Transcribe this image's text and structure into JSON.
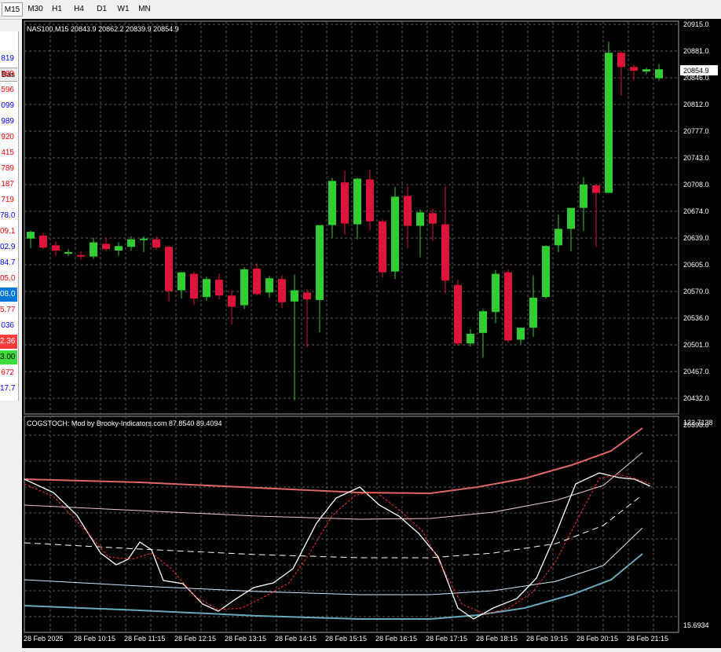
{
  "timeframes": [
    "M15",
    "M30",
    "H1",
    "H4",
    "D1",
    "W1",
    "MN"
  ],
  "active_timeframe": "M15",
  "side_panel": {
    "header": "Bas",
    "values": [
      {
        "text": "819",
        "color": "#0000ff"
      },
      {
        "text": "589",
        "color": "#ff0000"
      },
      {
        "text": "596",
        "color": "#ff0000"
      },
      {
        "text": "099",
        "color": "#0000ff"
      },
      {
        "text": "989",
        "color": "#0000ff"
      },
      {
        "text": "920",
        "color": "#ff0000"
      },
      {
        "text": "415",
        "color": "#ff0000"
      },
      {
        "text": "789",
        "color": "#ff0000"
      },
      {
        "text": "187",
        "color": "#ff0000"
      },
      {
        "text": "719",
        "color": "#ff0000"
      },
      {
        "text": "78.0",
        "color": "#0000ff"
      },
      {
        "text": "09.1",
        "color": "#ff0000"
      },
      {
        "text": "02.9",
        "color": "#0000ff"
      },
      {
        "text": "84.7",
        "color": "#0000ff"
      },
      {
        "text": "05.0",
        "color": "#ff0000"
      },
      {
        "text": "08.0",
        "color": "#ffffff",
        "bg": "#0078d7"
      },
      {
        "text": "5.77",
        "color": "#ff0000"
      },
      {
        "text": "036",
        "color": "#0000ff"
      },
      {
        "text": "2.36",
        "color": "#ffffff",
        "bg": "#ff3c3c"
      },
      {
        "text": "3.00",
        "color": "#000000",
        "bg": "#3cdc3c"
      },
      {
        "text": "672",
        "color": "#ff0000"
      },
      {
        "text": "17.7",
        "color": "#0000ff"
      }
    ]
  },
  "main_chart": {
    "info": "NAS100,M15  20843.9 20862.2 20839.9 20854.9",
    "price_labels": [
      "20915.0",
      "20881.0",
      "20846.0",
      "20812.0",
      "20777.0",
      "20743.0",
      "20708.0",
      "20674.0",
      "20639.0",
      "20605.0",
      "20570.0",
      "20536.0",
      "20501.0",
      "20467.0",
      "20432.0",
      "20398.0"
    ],
    "current_price": "20854.9",
    "colors": {
      "bull": "#32cd32",
      "bear": "#dc143c",
      "grid": "#6a6a6a",
      "text": "#ffffff"
    }
  },
  "indicator": {
    "info": "COGSTOCH: Mod by Brooky-Indicators.com 87.8540 89.4094",
    "top_label": "122.7138",
    "bottom_label": "15.6934"
  },
  "time_labels": [
    "28 Feb 2025",
    "28 Feb 10:15",
    "28 Feb 11:15",
    "28 Feb 12:15",
    "28 Feb 13:15",
    "28 Feb 14:15",
    "28 Feb 15:15",
    "28 Feb 16:15",
    "28 Feb 17:15",
    "28 Feb 18:15",
    "28 Feb 19:15",
    "28 Feb 20:15",
    "28 Feb 21:15"
  ],
  "chart_data": {
    "type": "candlestick",
    "symbol": "NAS100",
    "timeframe": "M15",
    "ylim": [
      20398.0,
      20915.0
    ],
    "candles": [
      {
        "o": 20629,
        "h": 20640,
        "l": 20616,
        "c": 20638
      },
      {
        "o": 20633,
        "h": 20637,
        "l": 20615,
        "c": 20617
      },
      {
        "o": 20620,
        "h": 20625,
        "l": 20606,
        "c": 20613
      },
      {
        "o": 20609,
        "h": 20615,
        "l": 20606,
        "c": 20611
      },
      {
        "o": 20607,
        "h": 20612,
        "l": 20601,
        "c": 20605
      },
      {
        "o": 20605,
        "h": 20630,
        "l": 20602,
        "c": 20624
      },
      {
        "o": 20622,
        "h": 20630,
        "l": 20612,
        "c": 20615
      },
      {
        "o": 20613,
        "h": 20624,
        "l": 20606,
        "c": 20619
      },
      {
        "o": 20618,
        "h": 20632,
        "l": 20613,
        "c": 20628
      },
      {
        "o": 20627,
        "h": 20632,
        "l": 20611,
        "c": 20629
      },
      {
        "o": 20628,
        "h": 20632,
        "l": 20614,
        "c": 20617
      },
      {
        "o": 20618,
        "h": 20620,
        "l": 20545,
        "c": 20559
      },
      {
        "o": 20560,
        "h": 20584,
        "l": 20549,
        "c": 20584
      },
      {
        "o": 20582,
        "h": 20585,
        "l": 20540,
        "c": 20549
      },
      {
        "o": 20551,
        "h": 20578,
        "l": 20546,
        "c": 20575
      },
      {
        "o": 20574,
        "h": 20582,
        "l": 20548,
        "c": 20553
      },
      {
        "o": 20553,
        "h": 20560,
        "l": 20514,
        "c": 20538
      },
      {
        "o": 20540,
        "h": 20591,
        "l": 20535,
        "c": 20588
      },
      {
        "o": 20589,
        "h": 20596,
        "l": 20553,
        "c": 20555
      },
      {
        "o": 20557,
        "h": 20579,
        "l": 20550,
        "c": 20576
      },
      {
        "o": 20575,
        "h": 20580,
        "l": 20536,
        "c": 20544
      },
      {
        "o": 20545,
        "h": 20581,
        "l": 20413,
        "c": 20560
      },
      {
        "o": 20557,
        "h": 20561,
        "l": 20484,
        "c": 20548
      },
      {
        "o": 20547,
        "h": 20644,
        "l": 20504,
        "c": 20647
      },
      {
        "o": 20647,
        "h": 20710,
        "l": 20630,
        "c": 20706
      },
      {
        "o": 20704,
        "h": 20720,
        "l": 20634,
        "c": 20649
      },
      {
        "o": 20648,
        "h": 20710,
        "l": 20628,
        "c": 20709
      },
      {
        "o": 20708,
        "h": 20721,
        "l": 20640,
        "c": 20652
      },
      {
        "o": 20652,
        "h": 20655,
        "l": 20577,
        "c": 20584
      },
      {
        "o": 20585,
        "h": 20698,
        "l": 20575,
        "c": 20685
      },
      {
        "o": 20686,
        "h": 20699,
        "l": 20616,
        "c": 20646
      },
      {
        "o": 20646,
        "h": 20668,
        "l": 20604,
        "c": 20664
      },
      {
        "o": 20663,
        "h": 20669,
        "l": 20626,
        "c": 20649
      },
      {
        "o": 20648,
        "h": 20699,
        "l": 20555,
        "c": 20573
      },
      {
        "o": 20567,
        "h": 20574,
        "l": 20486,
        "c": 20489
      },
      {
        "o": 20489,
        "h": 20508,
        "l": 20485,
        "c": 20502
      },
      {
        "o": 20503,
        "h": 20535,
        "l": 20470,
        "c": 20532
      },
      {
        "o": 20531,
        "h": 20587,
        "l": 20516,
        "c": 20582
      },
      {
        "o": 20584,
        "h": 20588,
        "l": 20490,
        "c": 20493
      },
      {
        "o": 20494,
        "h": 20510,
        "l": 20488,
        "c": 20510
      },
      {
        "o": 20510,
        "h": 20580,
        "l": 20498,
        "c": 20550
      },
      {
        "o": 20551,
        "h": 20620,
        "l": 20549,
        "c": 20619
      },
      {
        "o": 20620,
        "h": 20661,
        "l": 20611,
        "c": 20642
      },
      {
        "o": 20642,
        "h": 20669,
        "l": 20612,
        "c": 20670
      },
      {
        "o": 20670,
        "h": 20711,
        "l": 20639,
        "c": 20701
      },
      {
        "o": 20700,
        "h": 20702,
        "l": 20618,
        "c": 20690
      },
      {
        "o": 20690,
        "h": 20892,
        "l": 20692,
        "c": 20877
      },
      {
        "o": 20877,
        "h": 20879,
        "l": 20820,
        "c": 20858
      },
      {
        "o": 20858,
        "h": 20861,
        "l": 20840,
        "c": 20853
      },
      {
        "o": 20852,
        "h": 20857,
        "l": 20849,
        "c": 20855
      },
      {
        "o": 20843,
        "h": 20862,
        "l": 20840,
        "c": 20855
      }
    ],
    "indicator": {
      "name": "COGSTOCH",
      "ylim": [
        15.6934,
        122.7138
      ],
      "values": [
        87.854,
        89.4094
      ]
    }
  }
}
